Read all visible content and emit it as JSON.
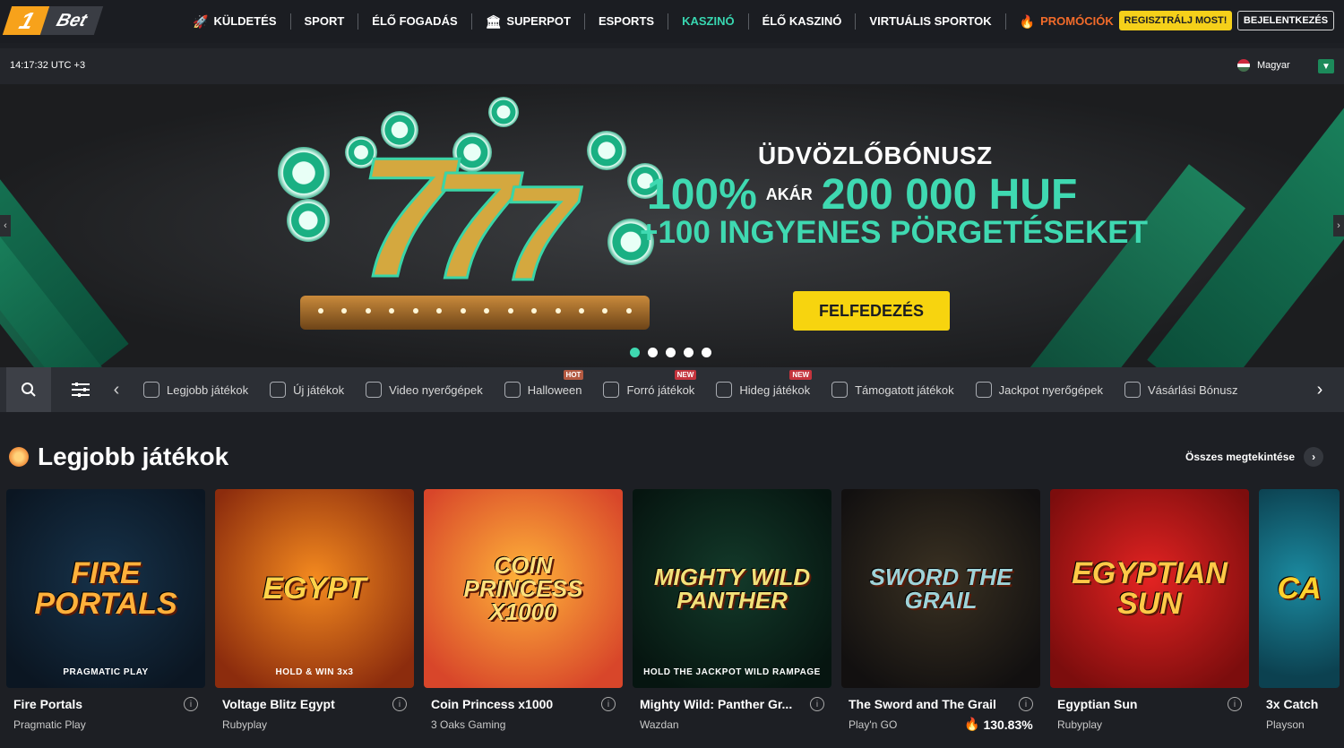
{
  "brand": {
    "one": "1",
    "bet": "Bet"
  },
  "nav": [
    {
      "label": "KÜLDETÉS",
      "icon": "rocket-icon",
      "glyph": "🚀",
      "state": "normal"
    },
    {
      "label": "SPORT",
      "icon": "",
      "glyph": "",
      "state": "normal"
    },
    {
      "label": "ÉLŐ FOGADÁS",
      "icon": "",
      "glyph": "",
      "state": "normal"
    },
    {
      "label": "SUPERPOT",
      "icon": "superpot-icon",
      "glyph": "🏛",
      "state": "normal"
    },
    {
      "label": "ESPORTS",
      "icon": "",
      "glyph": "",
      "state": "normal"
    },
    {
      "label": "KASZINÓ",
      "icon": "",
      "glyph": "",
      "state": "active"
    },
    {
      "label": "ÉLŐ KASZINÓ",
      "icon": "",
      "glyph": "",
      "state": "normal"
    },
    {
      "label": "VIRTUÁLIS SPORTOK",
      "icon": "",
      "glyph": "",
      "state": "normal"
    },
    {
      "label": "PROMÓCIÓK",
      "icon": "fire-icon",
      "glyph": "🔥",
      "state": "promo"
    }
  ],
  "auth": {
    "register": "REGISZTRÁLJ MOST!",
    "login": "BEJELENTKEZÉS"
  },
  "subbar": {
    "clock": "14:17:32 UTC +3",
    "language": "Magyar"
  },
  "banner": {
    "title": "ÜDVÖZLŐBÓNUSZ",
    "percent": "100%",
    "upto": "AKÁR",
    "amount": "200 000 HUF",
    "line2": "+100 INGYENES PÖRGETÉSEKET",
    "cta": "FELFEDEZÉS",
    "slides": 5,
    "active_slide": 1
  },
  "categories": [
    {
      "label": "Legjobb játékok",
      "icon": "trophy-icon",
      "badge": ""
    },
    {
      "label": "Új játékok",
      "icon": "new-icon",
      "badge": ""
    },
    {
      "label": "Video nyerőgépek",
      "icon": "slot-machine-icon",
      "badge": ""
    },
    {
      "label": "Halloween",
      "icon": "pumpkin-icon",
      "badge": "HOT"
    },
    {
      "label": "Forró játékok",
      "icon": "flame-icon",
      "badge": "NEW"
    },
    {
      "label": "Hideg játékok",
      "icon": "snowflake-icon",
      "badge": "NEW"
    },
    {
      "label": "Támogatott játékok",
      "icon": "sort-icon",
      "badge": ""
    },
    {
      "label": "Jackpot nyerőgépek",
      "icon": "diamond-icon",
      "badge": ""
    },
    {
      "label": "Vásárlási Bónusz",
      "icon": "gift-icon",
      "badge": ""
    }
  ],
  "section": {
    "title": "Legjobb játékok",
    "see_all": "Összes megtekintése"
  },
  "games": [
    {
      "name": "Fire Portals",
      "provider": "Pragmatic Play",
      "art": "FIRE PORTALS",
      "art_label": "PRAGMATIC PLAY",
      "rtp": "",
      "bg": "#16324a",
      "bg2": "#0b1622",
      "art_color": "#ffb13b"
    },
    {
      "name": "Voltage Blitz Egypt",
      "provider": "Rubyplay",
      "art": "EGYPT",
      "art_label": "HOLD & WIN 3x3",
      "rtp": "",
      "bg": "#f48a1f",
      "bg2": "#8c2c0d",
      "art_color": "#ffd44a"
    },
    {
      "name": "Coin Princess x1000",
      "provider": "3 Oaks Gaming",
      "art": "COIN PRINCESS X1000",
      "art_label": "",
      "rtp": "",
      "bg": "#ffb339",
      "bg2": "#d8462a",
      "art_color": "#ffe07b"
    },
    {
      "name": "Mighty Wild: Panther Gr...",
      "provider": "Wazdan",
      "art": "MIGHTY WILD PANTHER",
      "art_label": "HOLD THE JACKPOT WILD RAMPAGE",
      "rtp": "",
      "bg": "#133a2a",
      "bg2": "#061510",
      "art_color": "#f2e27a"
    },
    {
      "name": "The Sword and The Grail",
      "provider": "Play'n GO",
      "art": "SWORD THE GRAIL",
      "art_label": "",
      "rtp": "130.83%",
      "bg": "#3a3122",
      "bg2": "#121010",
      "art_color": "#9fd3d9"
    },
    {
      "name": "Egyptian Sun",
      "provider": "Rubyplay",
      "art": "EGYPTIAN SUN",
      "art_label": "",
      "rtp": "",
      "bg": "#e32322",
      "bg2": "#7c0d0d",
      "art_color": "#ffc948"
    },
    {
      "name": "3x Catch",
      "provider": "Playson",
      "art": "CA",
      "art_label": "",
      "rtp": "",
      "bg": "#1b8aa0",
      "bg2": "#0c4150",
      "art_color": "#ffd22d"
    }
  ],
  "colors": {
    "accent": "#38d6b0",
    "cta": "#f7d40f",
    "promo": "#f26b2a",
    "background": "#1d1f24"
  }
}
